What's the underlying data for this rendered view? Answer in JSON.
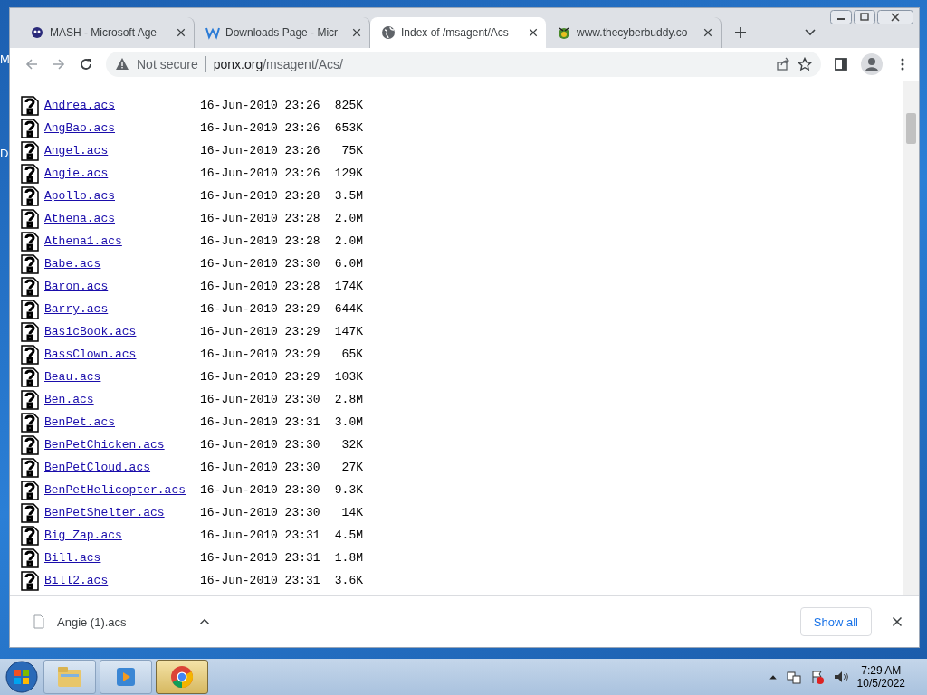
{
  "desktop": {
    "icon_labels": [
      "M",
      "D"
    ]
  },
  "tabs": [
    {
      "title": "MASH - Microsoft Age",
      "selected": false
    },
    {
      "title": "Downloads Page - Micr",
      "selected": false
    },
    {
      "title": "Index of /msagent/Acs",
      "selected": true
    },
    {
      "title": "www.thecyberbuddy.co",
      "selected": false
    }
  ],
  "address_bar": {
    "security": "Not secure",
    "host": "ponx.org",
    "path": "/msagent/Acs/"
  },
  "listing": [
    {
      "name": "Andrea.acs",
      "modified": "16-Jun-2010 23:26",
      "size": "825K"
    },
    {
      "name": "AngBao.acs",
      "modified": "16-Jun-2010 23:26",
      "size": "653K"
    },
    {
      "name": "Angel.acs",
      "modified": "16-Jun-2010 23:26",
      "size": "75K"
    },
    {
      "name": "Angie.acs",
      "modified": "16-Jun-2010 23:26",
      "size": "129K"
    },
    {
      "name": "Apollo.acs",
      "modified": "16-Jun-2010 23:28",
      "size": "3.5M"
    },
    {
      "name": "Athena.acs",
      "modified": "16-Jun-2010 23:28",
      "size": "2.0M"
    },
    {
      "name": "Athena1.acs",
      "modified": "16-Jun-2010 23:28",
      "size": "2.0M"
    },
    {
      "name": "Babe.acs",
      "modified": "16-Jun-2010 23:30",
      "size": "6.0M"
    },
    {
      "name": "Baron.acs",
      "modified": "16-Jun-2010 23:28",
      "size": "174K"
    },
    {
      "name": "Barry.acs",
      "modified": "16-Jun-2010 23:29",
      "size": "644K"
    },
    {
      "name": "BasicBook.acs",
      "modified": "16-Jun-2010 23:29",
      "size": "147K"
    },
    {
      "name": "BassClown.acs",
      "modified": "16-Jun-2010 23:29",
      "size": "65K"
    },
    {
      "name": "Beau.acs",
      "modified": "16-Jun-2010 23:29",
      "size": "103K"
    },
    {
      "name": "Ben.acs",
      "modified": "16-Jun-2010 23:30",
      "size": "2.8M"
    },
    {
      "name": "BenPet.acs",
      "modified": "16-Jun-2010 23:31",
      "size": "3.0M"
    },
    {
      "name": "BenPetChicken.acs",
      "modified": "16-Jun-2010 23:30",
      "size": "32K"
    },
    {
      "name": "BenPetCloud.acs",
      "modified": "16-Jun-2010 23:30",
      "size": "27K"
    },
    {
      "name": "BenPetHelicopter.acs",
      "modified": "16-Jun-2010 23:30",
      "size": "9.3K"
    },
    {
      "name": "BenPetShelter.acs",
      "modified": "16-Jun-2010 23:30",
      "size": "14K"
    },
    {
      "name": "Big_Zap.acs",
      "modified": "16-Jun-2010 23:31",
      "size": "4.5M"
    },
    {
      "name": "Bill.acs",
      "modified": "16-Jun-2010 23:31",
      "size": "1.8M"
    },
    {
      "name": "Bill2.acs",
      "modified": "16-Jun-2010 23:31",
      "size": "3.6K"
    }
  ],
  "download_bar": {
    "file": "Angie (1).acs",
    "show_all": "Show all"
  },
  "taskbar": {
    "apps": [
      {
        "selected": false
      },
      {
        "selected": false
      },
      {
        "selected": true
      }
    ],
    "time": "7:29 AM",
    "date": "10/5/2022"
  }
}
